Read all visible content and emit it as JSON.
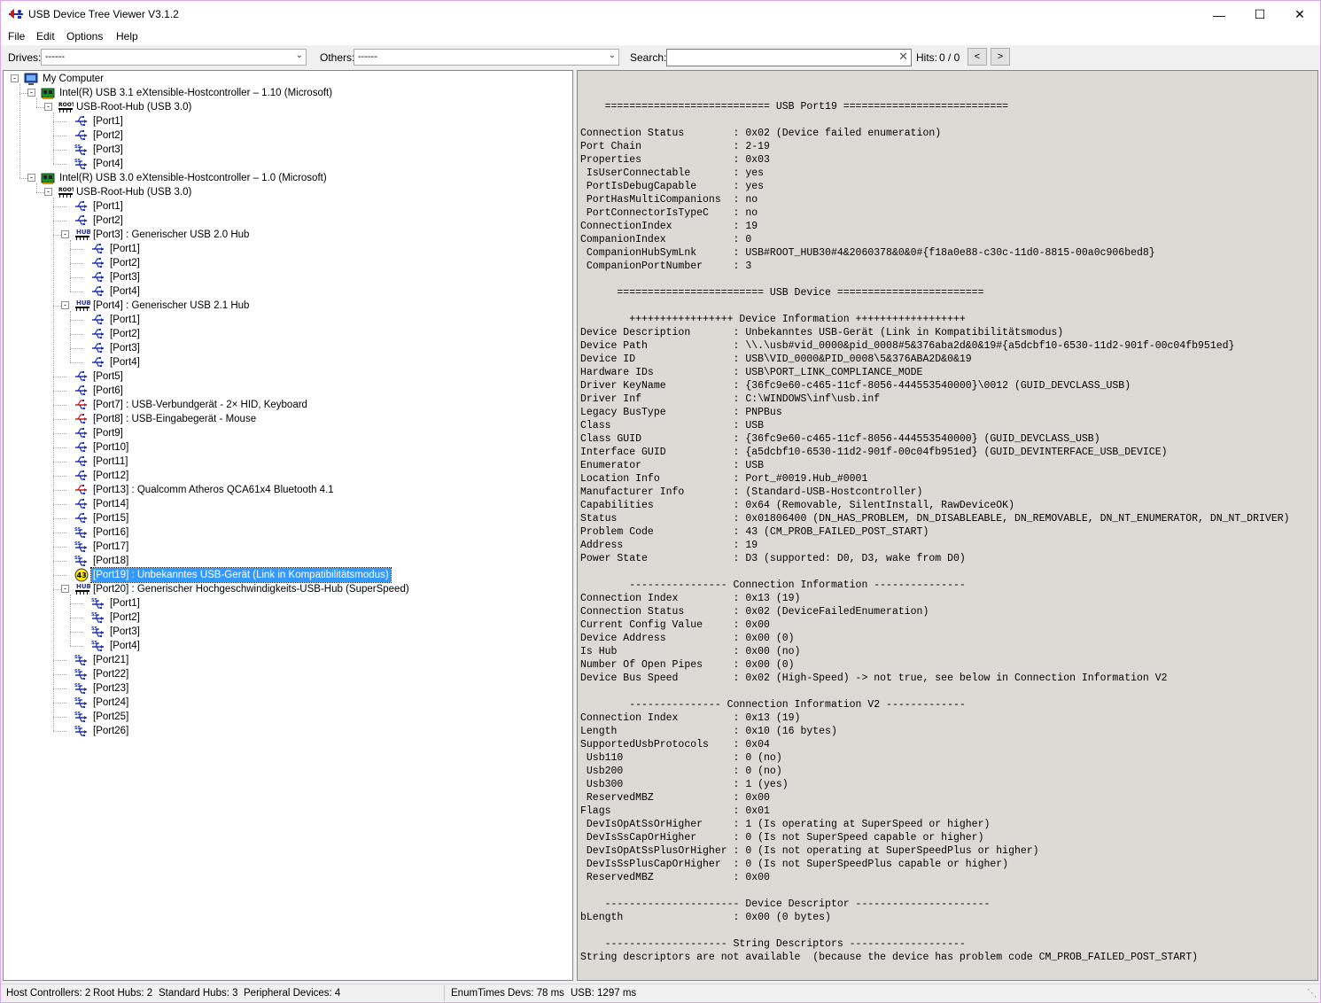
{
  "window": {
    "title": "USB Device Tree Viewer V3.1.2",
    "minimize": "—",
    "maximize": "☐",
    "close": "✕"
  },
  "menu": [
    "File",
    "Edit",
    "Options",
    "Help"
  ],
  "toolbar": {
    "drives_label": "Drives:",
    "drives_value": "------",
    "others_label": "Others:",
    "others_value": "------",
    "search_label": "Search:",
    "search_value": "",
    "hits_label": "Hits:",
    "hits_value": "0 / 0",
    "prev": "<",
    "next": ">"
  },
  "tree": [
    {
      "label": "My Computer",
      "depth": 0,
      "icon": "computer-icon",
      "expand": "-"
    },
    {
      "label": "Intel(R) USB 3.1 eXtensible-Hostcontroller – 1.10 (Microsoft)",
      "depth": 1,
      "icon": "controller-icon",
      "expand": "-"
    },
    {
      "label": "USB-Root-Hub (USB 3.0)",
      "depth": 2,
      "icon": "root-hub-icon",
      "expand": "-"
    },
    {
      "label": "[Port1]",
      "depth": 3,
      "icon": "usb-port-icon"
    },
    {
      "label": "[Port2]",
      "depth": 3,
      "icon": "usb-port-icon"
    },
    {
      "label": "[Port3]",
      "depth": 3,
      "icon": "usb3-port-icon"
    },
    {
      "label": "[Port4]",
      "depth": 3,
      "icon": "usb3-port-icon"
    },
    {
      "label": "Intel(R) USB 3.0 eXtensible-Hostcontroller – 1.0 (Microsoft)",
      "depth": 1,
      "icon": "controller-icon",
      "expand": "-"
    },
    {
      "label": "USB-Root-Hub (USB 3.0)",
      "depth": 2,
      "icon": "root-hub-icon",
      "expand": "-"
    },
    {
      "label": "[Port1]",
      "depth": 3,
      "icon": "usb-port-icon"
    },
    {
      "label": "[Port2]",
      "depth": 3,
      "icon": "usb-port-icon"
    },
    {
      "label": "[Port3] : Generischer USB 2.0 Hub",
      "depth": 3,
      "icon": "hub-icon",
      "expand": "-"
    },
    {
      "label": "[Port1]",
      "depth": 4,
      "icon": "usb-port-icon"
    },
    {
      "label": "[Port2]",
      "depth": 4,
      "icon": "usb-port-icon"
    },
    {
      "label": "[Port3]",
      "depth": 4,
      "icon": "usb-port-icon"
    },
    {
      "label": "[Port4]",
      "depth": 4,
      "icon": "usb-port-icon"
    },
    {
      "label": "[Port4] : Generischer USB 2.1 Hub",
      "depth": 3,
      "icon": "hub-icon",
      "expand": "-"
    },
    {
      "label": "[Port1]",
      "depth": 4,
      "icon": "usb-port-icon"
    },
    {
      "label": "[Port2]",
      "depth": 4,
      "icon": "usb-port-icon"
    },
    {
      "label": "[Port3]",
      "depth": 4,
      "icon": "usb-port-icon"
    },
    {
      "label": "[Port4]",
      "depth": 4,
      "icon": "usb-port-icon"
    },
    {
      "label": "[Port5]",
      "depth": 3,
      "icon": "usb-port-icon"
    },
    {
      "label": "[Port6]",
      "depth": 3,
      "icon": "usb-port-icon"
    },
    {
      "label": "[Port7] : USB-Verbundgerät - 2× HID, Keyboard",
      "depth": 3,
      "icon": "usb-device-icon"
    },
    {
      "label": "[Port8] : USB-Eingabegerät - Mouse",
      "depth": 3,
      "icon": "usb-device-icon"
    },
    {
      "label": "[Port9]",
      "depth": 3,
      "icon": "usb-port-icon"
    },
    {
      "label": "[Port10]",
      "depth": 3,
      "icon": "usb-port-icon"
    },
    {
      "label": "[Port11]",
      "depth": 3,
      "icon": "usb-port-icon"
    },
    {
      "label": "[Port12]",
      "depth": 3,
      "icon": "usb-port-icon"
    },
    {
      "label": "[Port13] : Qualcomm Atheros QCA61x4 Bluetooth 4.1",
      "depth": 3,
      "icon": "usb-device-icon"
    },
    {
      "label": "[Port14]",
      "depth": 3,
      "icon": "usb-port-icon"
    },
    {
      "label": "[Port15]",
      "depth": 3,
      "icon": "usb-port-icon"
    },
    {
      "label": "[Port16]",
      "depth": 3,
      "icon": "usb3-port-icon"
    },
    {
      "label": "[Port17]",
      "depth": 3,
      "icon": "usb3-port-icon"
    },
    {
      "label": "[Port18]",
      "depth": 3,
      "icon": "usb3-port-icon"
    },
    {
      "label": "[Port19] : Unbekanntes USB-Gerät (Link in Kompatibilitätsmodus)",
      "depth": 3,
      "icon": "problem-43-icon",
      "badge": "43",
      "selected": true
    },
    {
      "label": "[Port20] : Generischer Hochgeschwindigkeits-USB-Hub (SuperSpeed)",
      "depth": 3,
      "icon": "hub-icon",
      "expand": "-"
    },
    {
      "label": "[Port1]",
      "depth": 4,
      "icon": "usb3-port-icon"
    },
    {
      "label": "[Port2]",
      "depth": 4,
      "icon": "usb3-port-icon"
    },
    {
      "label": "[Port3]",
      "depth": 4,
      "icon": "usb3-port-icon"
    },
    {
      "label": "[Port4]",
      "depth": 4,
      "icon": "usb3-port-icon"
    },
    {
      "label": "[Port21]",
      "depth": 3,
      "icon": "usb3-port-icon"
    },
    {
      "label": "[Port22]",
      "depth": 3,
      "icon": "usb3-port-icon"
    },
    {
      "label": "[Port23]",
      "depth": 3,
      "icon": "usb3-port-icon"
    },
    {
      "label": "[Port24]",
      "depth": 3,
      "icon": "usb3-port-icon"
    },
    {
      "label": "[Port25]",
      "depth": 3,
      "icon": "usb3-port-icon"
    },
    {
      "label": "[Port26]",
      "depth": 3,
      "icon": "usb3-port-icon"
    }
  ],
  "details": "\n    =========================== USB Port19 ===========================\n\nConnection Status        : 0x02 (Device failed enumeration)\nPort Chain               : 2-19\nProperties               : 0x03\n IsUserConnectable       : yes\n PortIsDebugCapable      : yes\n PortHasMultiCompanions  : no\n PortConnectorIsTypeC    : no\nConnectionIndex          : 19\nCompanionIndex           : 0\n CompanionHubSymLnk      : USB#ROOT_HUB30#4&2060378&0&0#{f18a0e88-c30c-11d0-8815-00a0c906bed8}\n CompanionPortNumber     : 3\n\n      ======================== USB Device ========================\n\n        +++++++++++++++++ Device Information ++++++++++++++++++\nDevice Description       : Unbekanntes USB-Gerät (Link in Kompatibilitätsmodus)\nDevice Path              : \\\\.\\usb#vid_0000&pid_0008#5&376aba2d&0&19#{a5dcbf10-6530-11d2-901f-00c04fb951ed}\nDevice ID                : USB\\VID_0000&PID_0008\\5&376ABA2D&0&19\nHardware IDs             : USB\\PORT_LINK_COMPLIANCE_MODE\nDriver KeyName           : {36fc9e60-c465-11cf-8056-444553540000}\\0012 (GUID_DEVCLASS_USB)\nDriver Inf               : C:\\WINDOWS\\inf\\usb.inf\nLegacy BusType           : PNPBus\nClass                    : USB\nClass GUID               : {36fc9e60-c465-11cf-8056-444553540000} (GUID_DEVCLASS_USB)\nInterface GUID           : {a5dcbf10-6530-11d2-901f-00c04fb951ed} (GUID_DEVINTERFACE_USB_DEVICE)\nEnumerator               : USB\nLocation Info            : Port_#0019.Hub_#0001\nManufacturer Info        : (Standard-USB-Hostcontroller)\nCapabilities             : 0x64 (Removable, SilentInstall, RawDeviceOK)\nStatus                   : 0x01806400 (DN_HAS_PROBLEM, DN_DISABLEABLE, DN_REMOVABLE, DN_NT_ENUMERATOR, DN_NT_DRIVER)\nProblem Code             : 43 (CM_PROB_FAILED_POST_START)\nAddress                  : 19\nPower State              : D3 (supported: D0, D3, wake from D0)\n\n        ---------------- Connection Information ---------------\nConnection Index         : 0x13 (19)\nConnection Status        : 0x02 (DeviceFailedEnumeration)\nCurrent Config Value     : 0x00\nDevice Address           : 0x00 (0)\nIs Hub                   : 0x00 (no)\nNumber Of Open Pipes     : 0x00 (0)\nDevice Bus Speed         : 0x02 (High-Speed) -> not true, see below in Connection Information V2\n\n        --------------- Connection Information V2 -------------\nConnection Index         : 0x13 (19)\nLength                   : 0x10 (16 bytes)\nSupportedUsbProtocols    : 0x04\n Usb110                  : 0 (no)\n Usb200                  : 0 (no)\n Usb300                  : 1 (yes)\n ReservedMBZ             : 0x00\nFlags                    : 0x01\n DevIsOpAtSsOrHigher     : 1 (Is operating at SuperSpeed or higher)\n DevIsSsCapOrHigher      : 0 (Is not SuperSpeed capable or higher)\n DevIsOpAtSsPlusOrHigher : 0 (Is not operating at SuperSpeedPlus or higher)\n DevIsSsPlusCapOrHigher  : 0 (Is not SuperSpeedPlus capable or higher)\n ReservedMBZ             : 0x00\n\n    ---------------------- Device Descriptor ----------------------\nbLength                  : 0x00 (0 bytes)\n\n    -------------------- String Descriptors -------------------\nString descriptors are not available  (because the device has problem code CM_PROB_FAILED_POST_START)",
  "status": {
    "host_controllers": "Host Controllers: 2",
    "root_hubs": "Root Hubs: 2",
    "standard_hubs": "Standard Hubs: 3",
    "peripheral_devices": "Peripheral Devices: 4",
    "enum_times": "EnumTimes",
    "devs": "Devs: 78 ms",
    "usb": "USB: 1297 ms"
  },
  "colors": {
    "selection": "#3399ff",
    "details_bg": "#dcdad5",
    "usb_blue": "#1a2fb5",
    "usb_red": "#d01818",
    "problem_yellow": "#ffe800"
  }
}
